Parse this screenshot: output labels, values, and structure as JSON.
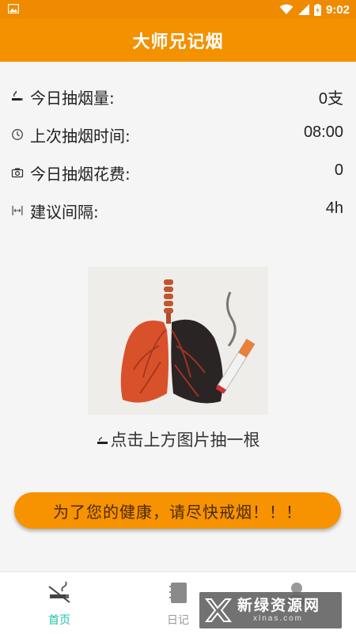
{
  "status_bar": {
    "time": "9:02"
  },
  "app_bar": {
    "title": "大师兄记烟"
  },
  "stats": [
    {
      "icon": "cigarette-icon",
      "label": "今日抽烟量:",
      "value": "0支"
    },
    {
      "icon": "clock-icon",
      "label": "上次抽烟时间:",
      "value": "08:00"
    },
    {
      "icon": "camera-icon",
      "label": "今日抽烟花费:",
      "value": "0"
    },
    {
      "icon": "interval-icon",
      "label": "建议间隔:",
      "value": "4h"
    }
  ],
  "hint": "点击上方图片抽一根",
  "warning": "为了您的健康，请尽快戒烟！！！",
  "bottom_nav": [
    {
      "icon": "no-smoking-icon",
      "label": "首页",
      "active": true
    },
    {
      "icon": "notebook-icon",
      "label": "日记",
      "active": false
    },
    {
      "icon": "profile-icon",
      "label": "",
      "active": false
    }
  ],
  "colors": {
    "primary": "#f39100",
    "active_nav": "#1ec0b0",
    "inactive_nav": "#9a9a9a"
  },
  "watermark": {
    "text": "新绿资源网",
    "sub": "xlnas.com"
  }
}
